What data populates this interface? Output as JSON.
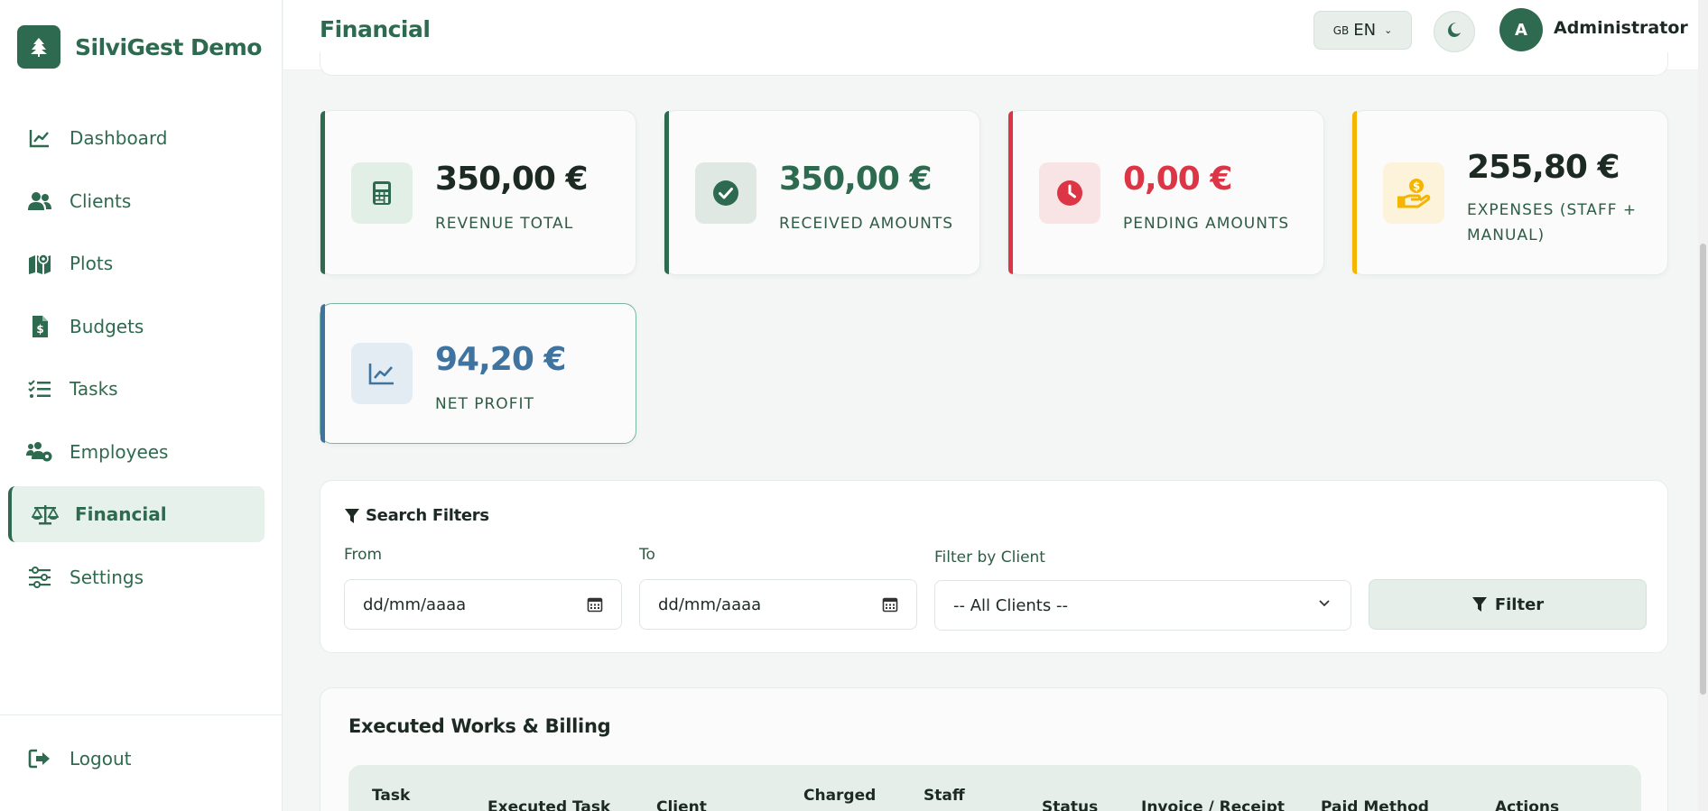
{
  "brand": {
    "name": "SilviGest Demo",
    "logo_icon": "tree-icon"
  },
  "sidebar": {
    "items": [
      {
        "label": "Dashboard",
        "icon": "chart-line-icon",
        "active": false
      },
      {
        "label": "Clients",
        "icon": "users-icon",
        "active": false
      },
      {
        "label": "Plots",
        "icon": "map-icon",
        "active": false
      },
      {
        "label": "Budgets",
        "icon": "invoice-icon",
        "active": false
      },
      {
        "label": "Tasks",
        "icon": "list-check-icon",
        "active": false
      },
      {
        "label": "Employees",
        "icon": "users-gear-icon",
        "active": false
      },
      {
        "label": "Financial",
        "icon": "scale-icon",
        "active": true
      },
      {
        "label": "Settings",
        "icon": "sliders-icon",
        "active": false
      }
    ],
    "logout_label": "Logout"
  },
  "header": {
    "title": "Financial",
    "language": {
      "flag": "GB",
      "code": "EN"
    },
    "user": {
      "initial": "A",
      "name": "Administrator"
    }
  },
  "stats": [
    {
      "value": "350,00 €",
      "label": "REVENUE TOTAL",
      "icon": "calculator-icon",
      "color": "#2e6a4f"
    },
    {
      "value": "350,00 €",
      "label": "RECEIVED AMOUNTS",
      "icon": "check-circle-icon",
      "color": "#2e6a4f"
    },
    {
      "value": "0,00 €",
      "label": "PENDING AMOUNTS",
      "icon": "clock-icon",
      "color": "#dc3545"
    },
    {
      "value": "255,80 €",
      "label_line1": "EXPENSES (STAFF +",
      "label_line2": "MANUAL)",
      "icon": "hand-money-icon",
      "color": "#f5b400"
    },
    {
      "value": "94,20 €",
      "label": "NET PROFIT",
      "icon": "chart-line-icon",
      "color": "#3f73a0"
    }
  ],
  "filters": {
    "title": "Search Filters",
    "from_label": "From",
    "from_value": "dd/mm/aaaa",
    "to_label": "To",
    "to_value": "dd/mm/aaaa",
    "client_label": "Filter by Client",
    "client_value": "-- All Clients --",
    "button_label": "Filter"
  },
  "works": {
    "title": "Executed Works & Billing",
    "columns": [
      "Task",
      "Executed Task",
      "Client",
      "Charged",
      "Staff",
      "Status",
      "Invoice / Receipt",
      "Paid Method",
      "Actions"
    ]
  }
}
